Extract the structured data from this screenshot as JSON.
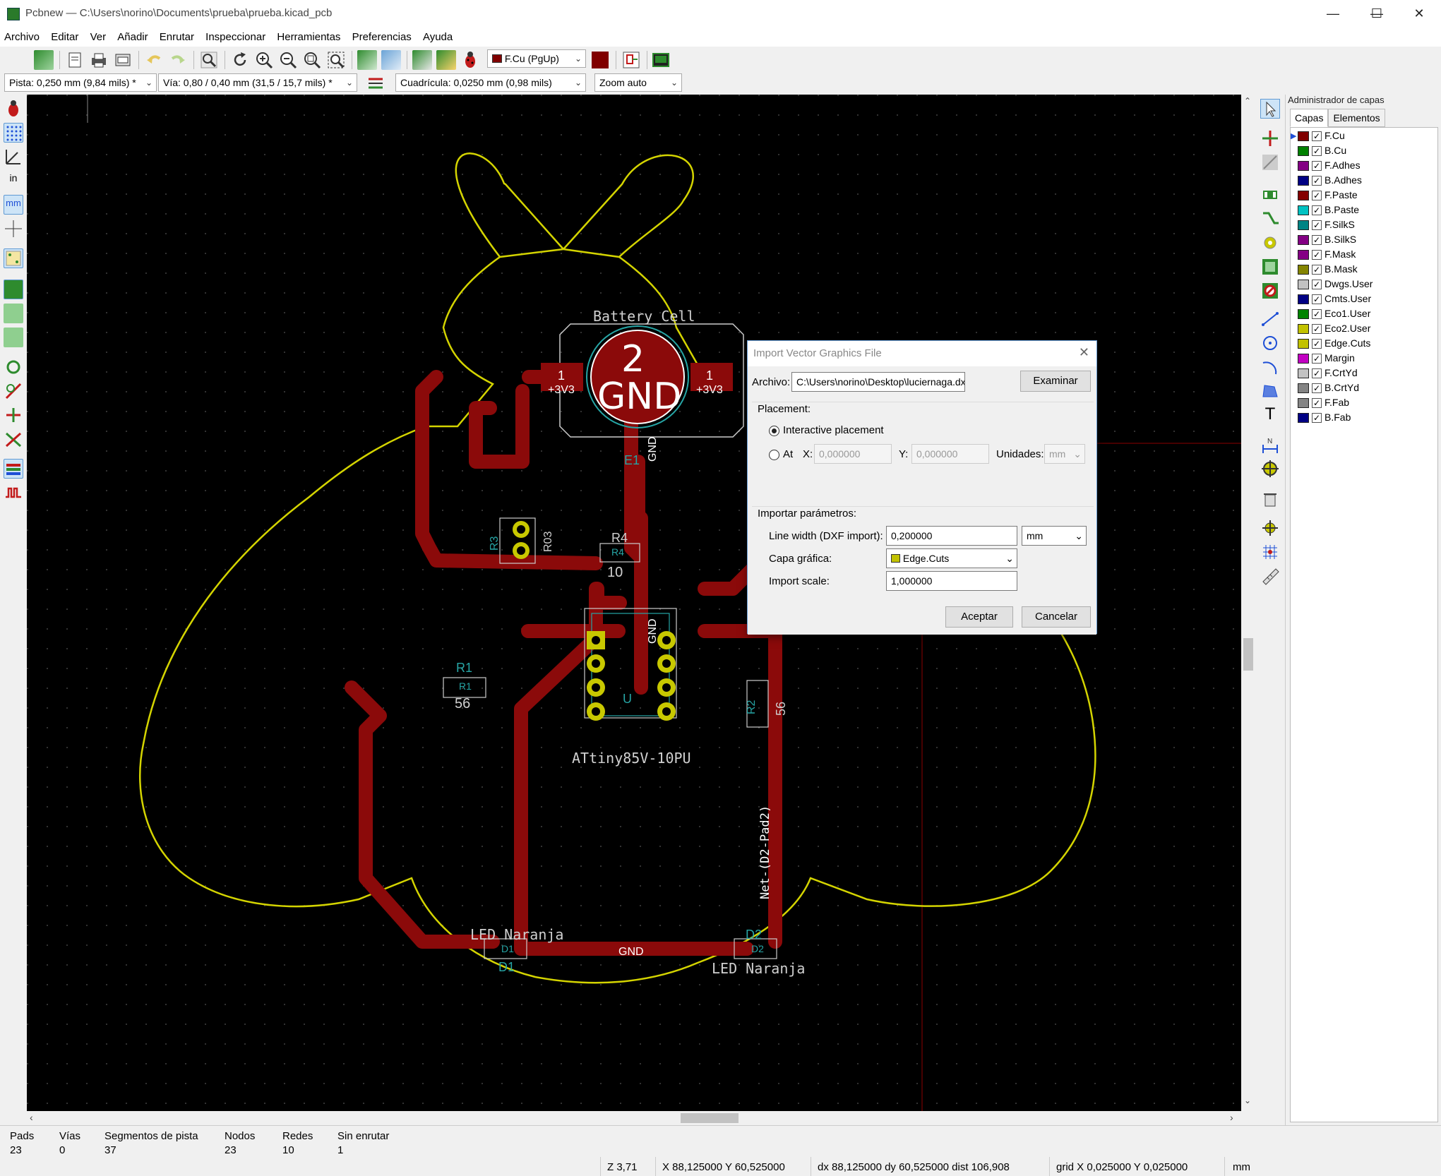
{
  "window": {
    "title": "Pcbnew — C:\\Users\\norino\\Documents\\prueba\\prueba.kicad_pcb",
    "minimize": "—",
    "maximize": "☐",
    "close": "✕"
  },
  "menu": [
    "Archivo",
    "Editar",
    "Ver",
    "Añadir",
    "Enrutar",
    "Inspeccionar",
    "Herramientas",
    "Preferencias",
    "Ayuda"
  ],
  "toolbar": {
    "layer_select": "F.Cu (PgUp)",
    "layer_color": "#800000"
  },
  "toolbar2": {
    "track": "Pista: 0,250 mm (9,84 mils) *",
    "via": "Vía: 0,80 / 0,40 mm (31,5 / 15,7 mils) *",
    "grid": "Cuadrícula: 0,0250 mm (0,98 mils)",
    "zoom": "Zoom auto"
  },
  "left_toolbar": {
    "units_in": "in",
    "units_mm": "mm"
  },
  "pcb": {
    "battery_ref": "Battery_Cell",
    "battery_pad_num": "2",
    "battery_net": "GND",
    "pad1_num_left": "1",
    "pad1_net_left": "+3V3",
    "pad1_num_right": "1",
    "pad1_net_right": "+3V3",
    "battery_label": "E1",
    "gnd_track_label_1": "GND",
    "gnd_track_label_2": "GND",
    "gnd_track_label_3": "GND",
    "r3_ref": "R3",
    "r3_val": "R03",
    "r4_ref": "R4",
    "r4_val": "R4",
    "r4_extra": "10",
    "u1_ref": "U",
    "u1_part": "ATtiny85V-10PU",
    "r1_ref": "R1",
    "r1_inner": "R1",
    "r1_val": "56",
    "r2_ref": "R2",
    "r2_val": "56",
    "net_label": "Net-(D2-Pad2)",
    "d1_ref": "D1",
    "d1_inner": "D1",
    "d1_label": "LED Naranja",
    "d2_ref": "D2",
    "d2_inner": "D2",
    "d2_label": "LED Naranja",
    "colors": {
      "edge": "#d4d400",
      "copper": "#8b0a0a",
      "pad": "#c8c800",
      "silk": "#d0d0d0",
      "fab": "#26a5a5"
    }
  },
  "layer_manager": {
    "header": "Administrador de capas",
    "tabs": [
      "Capas",
      "Elementos"
    ],
    "layers": [
      {
        "name": "F.Cu",
        "color": "#800000",
        "active": true
      },
      {
        "name": "B.Cu",
        "color": "#008000"
      },
      {
        "name": "F.Adhes",
        "color": "#840084"
      },
      {
        "name": "B.Adhes",
        "color": "#000084"
      },
      {
        "name": "F.Paste",
        "color": "#840000"
      },
      {
        "name": "B.Paste",
        "color": "#00c2c2"
      },
      {
        "name": "F.SilkS",
        "color": "#008484"
      },
      {
        "name": "B.SilkS",
        "color": "#840084"
      },
      {
        "name": "F.Mask",
        "color": "#840084"
      },
      {
        "name": "B.Mask",
        "color": "#848400"
      },
      {
        "name": "Dwgs.User",
        "color": "#c2c2c2"
      },
      {
        "name": "Cmts.User",
        "color": "#000084"
      },
      {
        "name": "Eco1.User",
        "color": "#008400"
      },
      {
        "name": "Eco2.User",
        "color": "#c2c200"
      },
      {
        "name": "Edge.Cuts",
        "color": "#c2c200"
      },
      {
        "name": "Margin",
        "color": "#c200c2"
      },
      {
        "name": "F.CrtYd",
        "color": "#c2c2c2"
      },
      {
        "name": "B.CrtYd",
        "color": "#848484"
      },
      {
        "name": "F.Fab",
        "color": "#848484"
      },
      {
        "name": "B.Fab",
        "color": "#000084"
      }
    ]
  },
  "status": {
    "columns": [
      {
        "label": "Pads",
        "value": "23"
      },
      {
        "label": "Vías",
        "value": "0"
      },
      {
        "label": "Segmentos de pista",
        "value": "37"
      },
      {
        "label": "Nodos",
        "value": "23"
      },
      {
        "label": "Redes",
        "value": "10"
      },
      {
        "label": "Sin enrutar",
        "value": "1"
      }
    ],
    "zoom": "Z 3,71",
    "xy": "X 88,125000  Y 60,525000",
    "dxy": "dx 88,125000  dy 60,525000  dist 106,908",
    "grid": "grid X 0,025000  Y 0,025000",
    "units": "mm"
  },
  "dialog": {
    "title": "Import Vector Graphics File",
    "file_label": "Archivo:",
    "file_value": "C:\\Users\\norino\\Desktop\\luciernaga.dxf",
    "browse": "Examinar",
    "placement_group": "Placement:",
    "interactive": "Interactive placement",
    "at": "At",
    "x_label": "X:",
    "x_value": "0,000000",
    "y_label": "Y:",
    "y_value": "0,000000",
    "units_label": "Unidades:",
    "units_value": "mm",
    "params_group": "Importar parámetros:",
    "line_width_label": "Line width (DXF import):",
    "line_width_value": "0,200000",
    "line_width_unit": "mm",
    "layer_label": "Capa gráfica:",
    "layer_value": "Edge.Cuts",
    "layer_color": "#c2c200",
    "scale_label": "Import scale:",
    "scale_value": "1,000000",
    "ok": "Aceptar",
    "cancel": "Cancelar"
  }
}
